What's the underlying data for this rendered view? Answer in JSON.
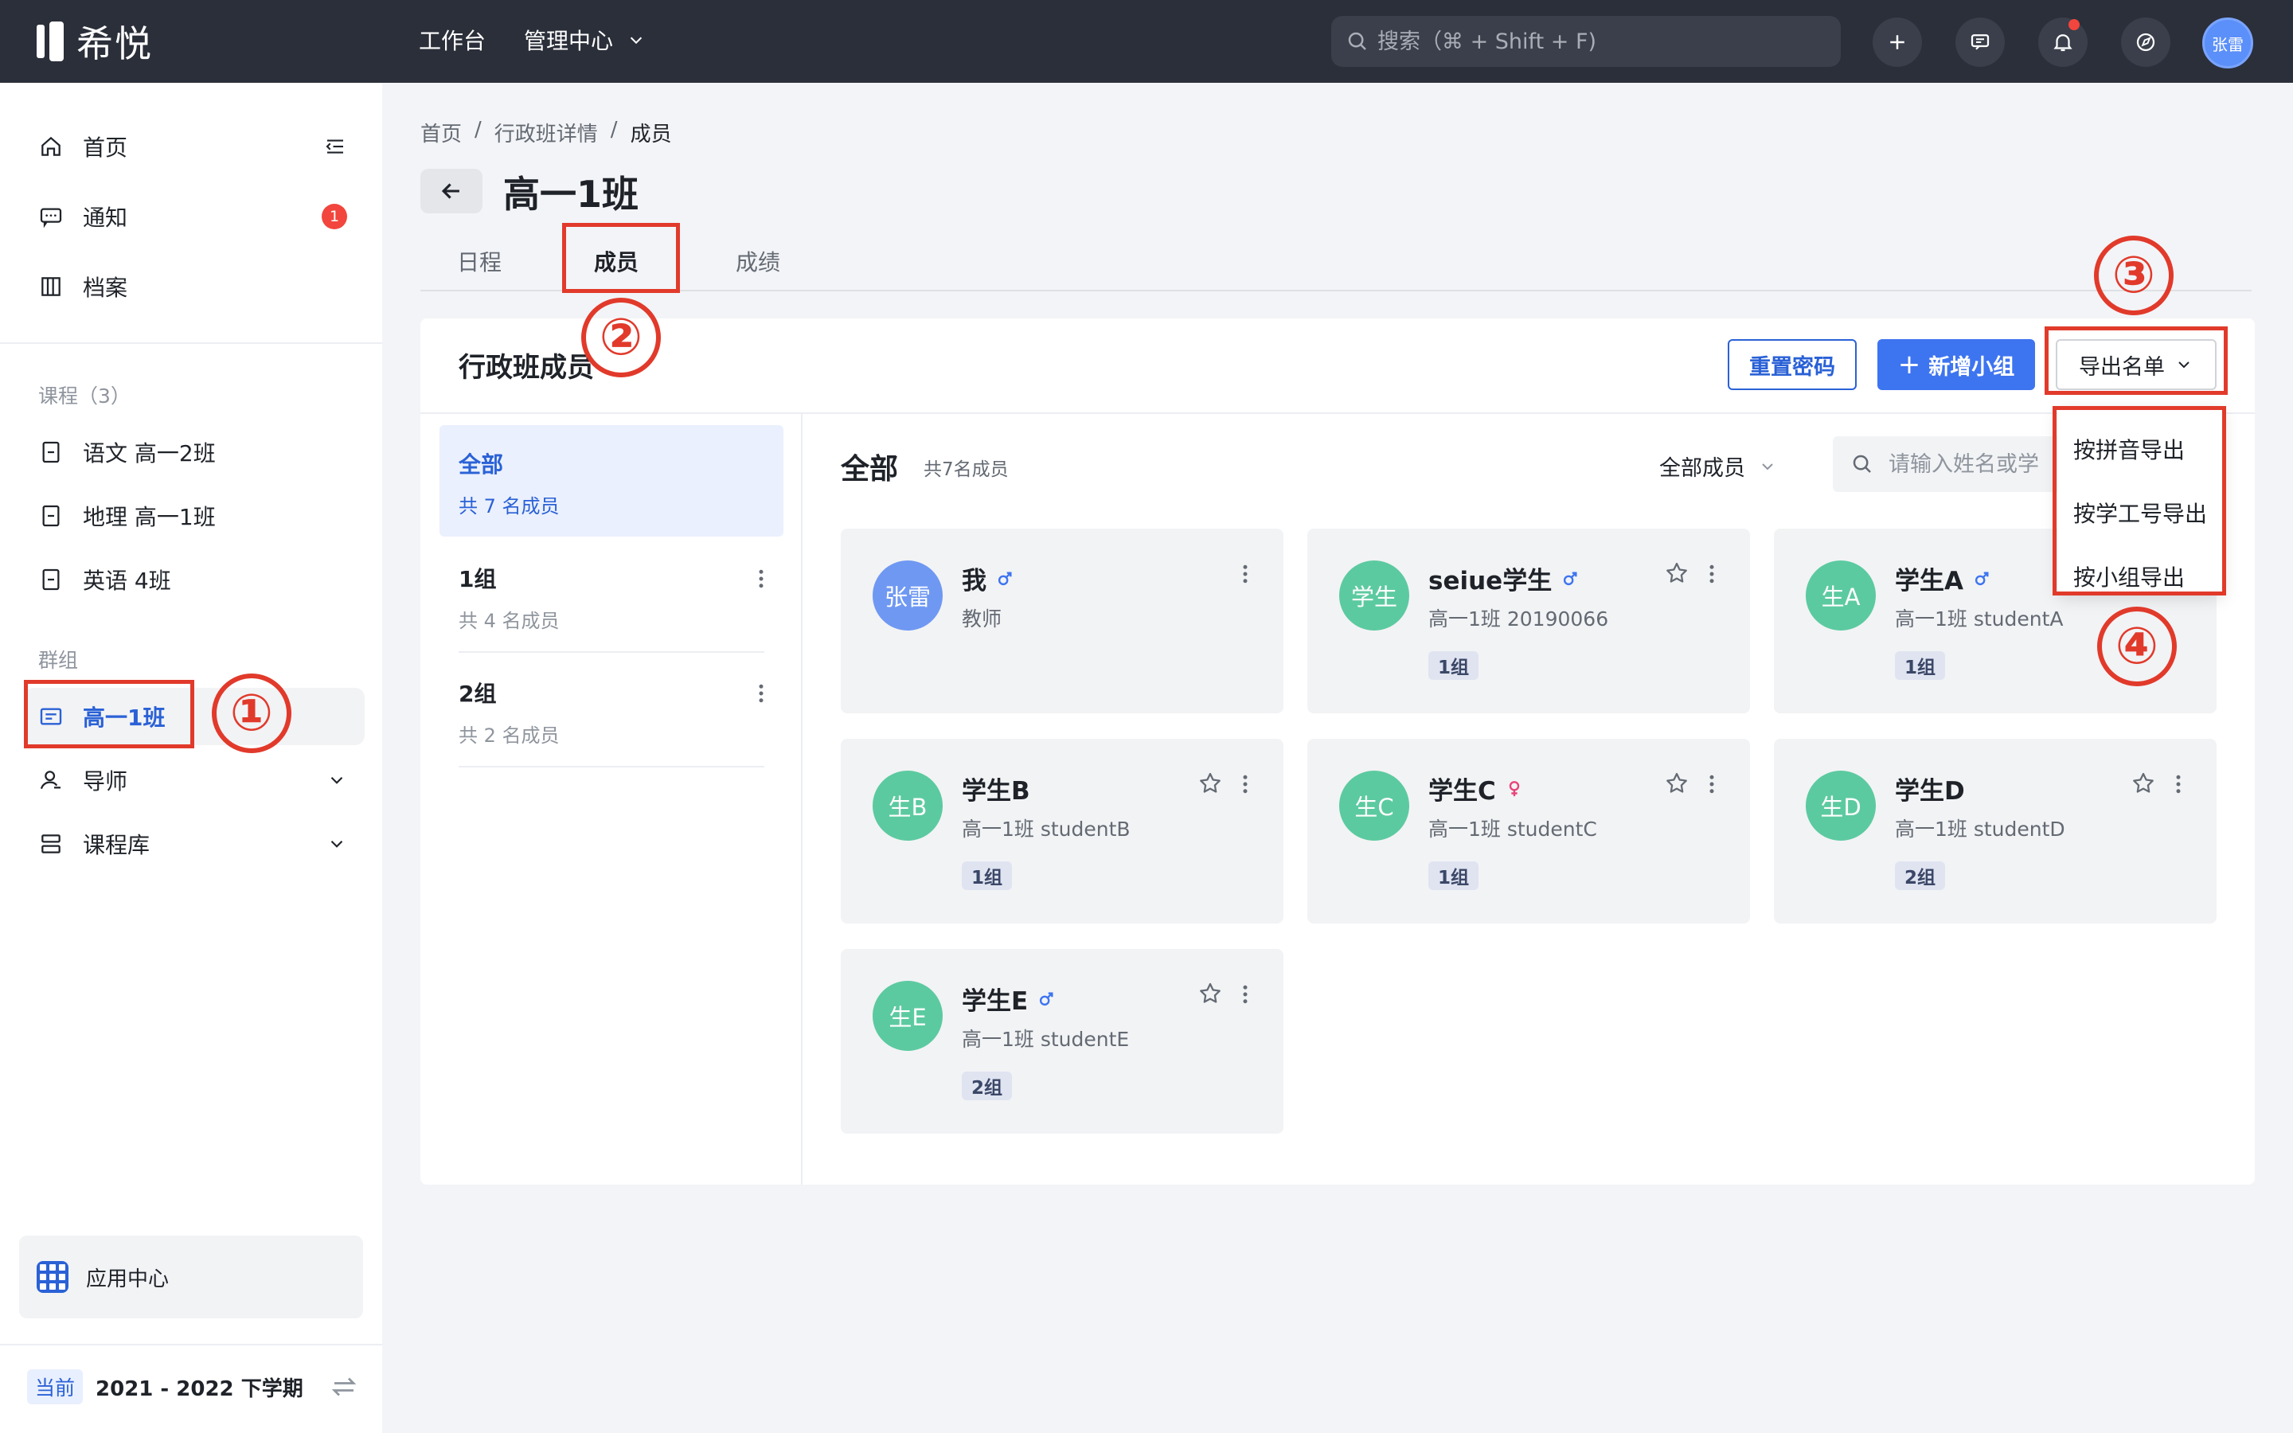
{
  "topbar": {
    "logo_text": "希悦",
    "nav": [
      {
        "label": "工作台"
      },
      {
        "label": "管理中心"
      }
    ],
    "search_placeholder": "搜索（⌘ + Shift + F)",
    "avatar": "张雷"
  },
  "sidebar": {
    "items": [
      {
        "label": "首页",
        "icon": "home-icon"
      },
      {
        "label": "通知",
        "icon": "message-icon",
        "badge": "1"
      },
      {
        "label": "档案",
        "icon": "archive-icon"
      }
    ],
    "courses_section": "课程（3）",
    "courses": [
      {
        "label": "语文 高一2班"
      },
      {
        "label": "地理 高一1班"
      },
      {
        "label": "英语 4班"
      }
    ],
    "groups_section": "群组",
    "groups": [
      {
        "label": "高一1班",
        "active": true
      },
      {
        "label": "导师"
      },
      {
        "label": "课程库"
      }
    ],
    "app_center": "应用中心",
    "term_tag": "当前",
    "term": "2021 - 2022 下学期"
  },
  "breadcrumb": [
    "首页",
    "/",
    "行政班详情",
    "/",
    "成员"
  ],
  "page_title": "高一1班",
  "tabs": [
    {
      "label": "日程"
    },
    {
      "label": "成员",
      "active": true
    },
    {
      "label": "成绩"
    }
  ],
  "panel": {
    "title": "行政班成员",
    "reset_password": "重置密码",
    "add_group": "新增小组",
    "add_icon": "+",
    "export": "导出名单",
    "export_options": [
      "按拼音导出",
      "按学工号导出",
      "按小组导出"
    ]
  },
  "groups": [
    {
      "name": "全部",
      "count": "共 7 名成员",
      "active": true
    },
    {
      "name": "1组",
      "count": "共 4 名成员"
    },
    {
      "name": "2组",
      "count": "共 2 名成员"
    }
  ],
  "members_area": {
    "title": "全部",
    "count": "共7名成员",
    "filter": "全部成员",
    "search_placeholder": "请输入姓名或学"
  },
  "members": [
    {
      "avatar": "张雷",
      "name": "我",
      "gender": "male",
      "sub": "教师",
      "tag": "",
      "avatar_color": "#6f98f2",
      "star": false
    },
    {
      "avatar": "学生",
      "name": "seiue学生",
      "gender": "male",
      "sub": "高一1班 20190066",
      "tag": "1组",
      "avatar_color": "#5ccaa0",
      "star": true
    },
    {
      "avatar": "生A",
      "name": "学生A",
      "gender": "male",
      "sub": "高一1班 studentA",
      "tag": "1组",
      "avatar_color": "#5ccaa0",
      "star": true
    },
    {
      "avatar": "生B",
      "name": "学生B",
      "gender": "",
      "sub": "高一1班 studentB",
      "tag": "1组",
      "avatar_color": "#5ccaa0",
      "star": true
    },
    {
      "avatar": "生C",
      "name": "学生C",
      "gender": "female",
      "sub": "高一1班 studentC",
      "tag": "1组",
      "avatar_color": "#5ccaa0",
      "star": true
    },
    {
      "avatar": "生D",
      "name": "学生D",
      "gender": "",
      "sub": "高一1班 studentD",
      "tag": "2组",
      "avatar_color": "#5ccaa0",
      "star": true
    },
    {
      "avatar": "生E",
      "name": "学生E",
      "gender": "male",
      "sub": "高一1班 studentE",
      "tag": "2组",
      "avatar_color": "#5ccaa0",
      "star": true
    }
  ],
  "annotations": [
    "①",
    "②",
    "③",
    "④"
  ],
  "colors": {
    "accent": "#2a61d6",
    "annotation": "#e13a2b",
    "male": "#3d74f0",
    "female": "#e8457a"
  }
}
